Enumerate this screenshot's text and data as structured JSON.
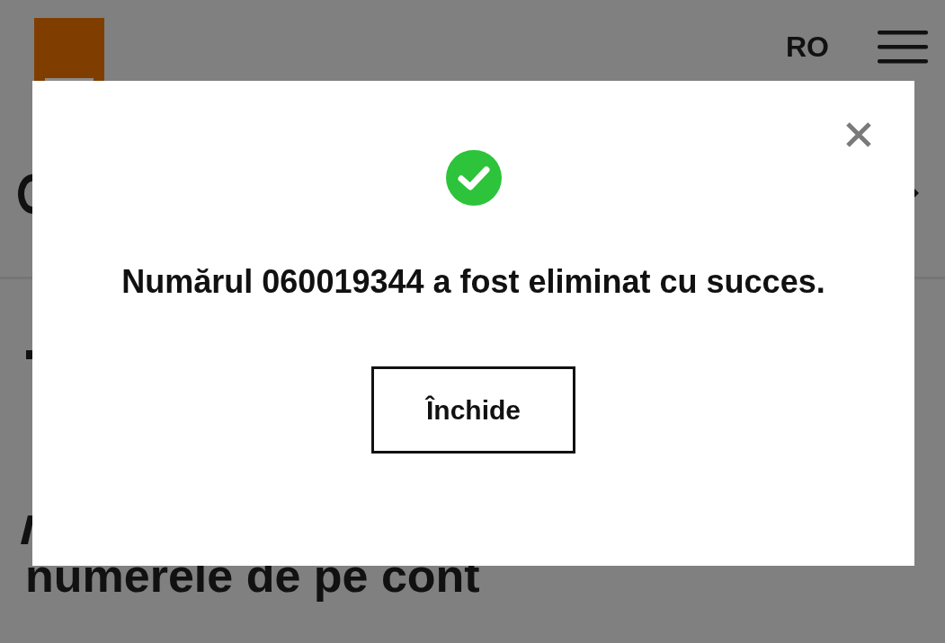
{
  "header": {
    "language": "RO"
  },
  "page": {
    "heading_tail": "numerele de pe cont"
  },
  "dialog": {
    "success": true,
    "message": "Numărul 060019344 a fost eliminat cu succes.",
    "button": "Închide"
  }
}
